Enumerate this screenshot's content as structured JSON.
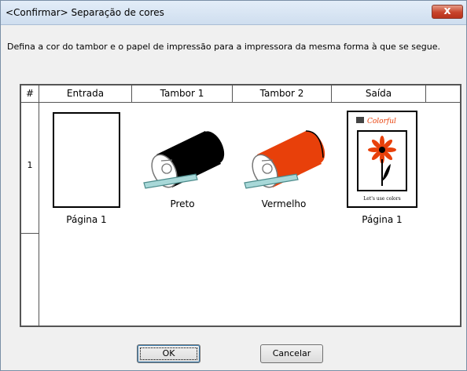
{
  "window": {
    "title": "<Confirmar> Separação de cores",
    "close_label": "x"
  },
  "instruction": "Defina a cor do tambor e o papel de impressão para a impressora da mesma forma à que se segue.",
  "table": {
    "headers": [
      "#",
      "Entrada",
      "Tambor 1",
      "Tambor 2",
      "Saída"
    ],
    "row": {
      "number": "1",
      "entrada_caption": "Página 1",
      "tambor1_caption": "Preto",
      "tambor2_caption": "Vermelho",
      "saida_caption": "Página 1"
    }
  },
  "colors": {
    "drum1": "#000000",
    "drum2": "#e8400a",
    "roller": "#a8d8d8"
  },
  "buttons": {
    "ok": "OK",
    "cancel": "Cancelar"
  }
}
